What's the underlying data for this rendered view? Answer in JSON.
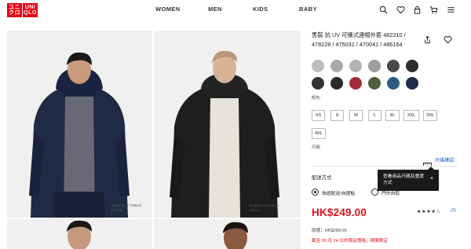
{
  "header": {
    "logo_top": "ユニ",
    "logo_top_right": "UNI",
    "logo_bottom": "クロ",
    "logo_bottom_right": "QLO",
    "nav": [
      "WOMEN",
      "MEN",
      "KIDS",
      "BABY"
    ],
    "icons": [
      "search-icon",
      "heart-icon",
      "user-icon",
      "cart-icon",
      "menu-icon"
    ]
  },
  "gallery": {
    "photos": [
      {
        "caption_line1": "Height:5'11\"/180cm",
        "caption_line2": "Size:XL",
        "jacket_color": "#1f2a44",
        "shirt_color": "#6b6876"
      },
      {
        "caption_line1": "Height:6'1\"/185cm",
        "caption_line2": "Size:L",
        "jacket_color": "#1d1f1f",
        "shirt_color": "#e6e3dc"
      }
    ]
  },
  "product": {
    "title": "男裝 抗 UV 可攜式連帽外套 482210 / 478228 / 475031 / 470041 / 486164",
    "color_label": "顏色:",
    "swatches": [
      "#bdbdbd",
      "#a9a9a9",
      "#b3b3b3",
      "#9e9e9e",
      "#4a4a4a",
      "#2c2c2c",
      "#333333",
      "#2a2a2a",
      "#a52a3a",
      "#4d5e3c",
      "#2f5d80",
      "#1e2a4a"
    ],
    "sizes": [
      "XS",
      "S",
      "M",
      "L",
      "XL",
      "XXL",
      "3XL",
      "4XL"
    ],
    "size_label": "尺碼:",
    "size_guide": "尺碼確認",
    "delivery_title": "配送方式",
    "delivery_options": [
      "快遞配送/自提點",
      "門市自取"
    ],
    "tooltip_text": "查看商品尺碼及重度方式",
    "tooltip_close": "×",
    "price": "HK$249.00",
    "stars": "★★★★☆",
    "review_count": "(2)",
    "original_price": "原價：HK$299.00",
    "promo_text": "截至 09 月 24 日的限定價格，期間限定"
  }
}
